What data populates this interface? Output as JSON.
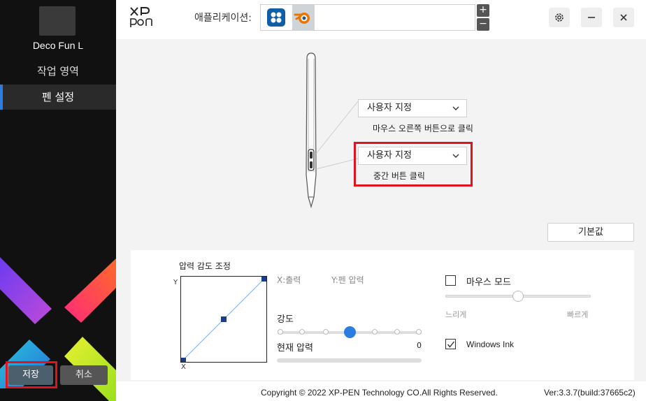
{
  "sidebar": {
    "device_name": "Deco Fun L",
    "nav": [
      {
        "label": "작업 영역",
        "active": false
      },
      {
        "label": "펜 설정",
        "active": true
      }
    ],
    "save_label": "저장",
    "cancel_label": "취소"
  },
  "header": {
    "logo": "XP-PEN",
    "app_label": "애플리케이션:",
    "apps": [
      {
        "icon": "app-globe-icon",
        "color": "#0e5ea8"
      },
      {
        "icon": "blender-icon",
        "color": "#ea7600"
      }
    ],
    "plus": "+",
    "minus": "−"
  },
  "pen": {
    "upper_button": {
      "value": "사용자 지정",
      "caption": "마우스 오른쪽 버튼으로 클릭"
    },
    "lower_button": {
      "value": "사용자 지정",
      "caption": "중간 버튼 클릭"
    },
    "default_label": "기본값"
  },
  "pressure": {
    "title": "압력 감도 조정",
    "axis_y": "Y",
    "axis_x": "X",
    "x_output_label": "X:출력",
    "y_pressure_label": "Y:펜 압력",
    "strength_label": "강도",
    "strength_level": 0.5,
    "current_label": "현재 압력",
    "current_value": "0"
  },
  "mouse_mode": {
    "label": "마우스 모드",
    "checked": false,
    "slow_label": "느리게",
    "fast_label": "빠르게",
    "speed_level": 0.5
  },
  "windows_ink": {
    "label": "Windows Ink",
    "checked": true
  },
  "footer": {
    "copyright": "Copyright © 2022  XP-PEN Technology CO.All Rights Reserved.",
    "version": "Ver:3.3.7(build:37665c2)"
  },
  "colors": {
    "accent": "#2b7de0",
    "highlight": "#e0141e",
    "sidebar_bg": "#111111"
  }
}
